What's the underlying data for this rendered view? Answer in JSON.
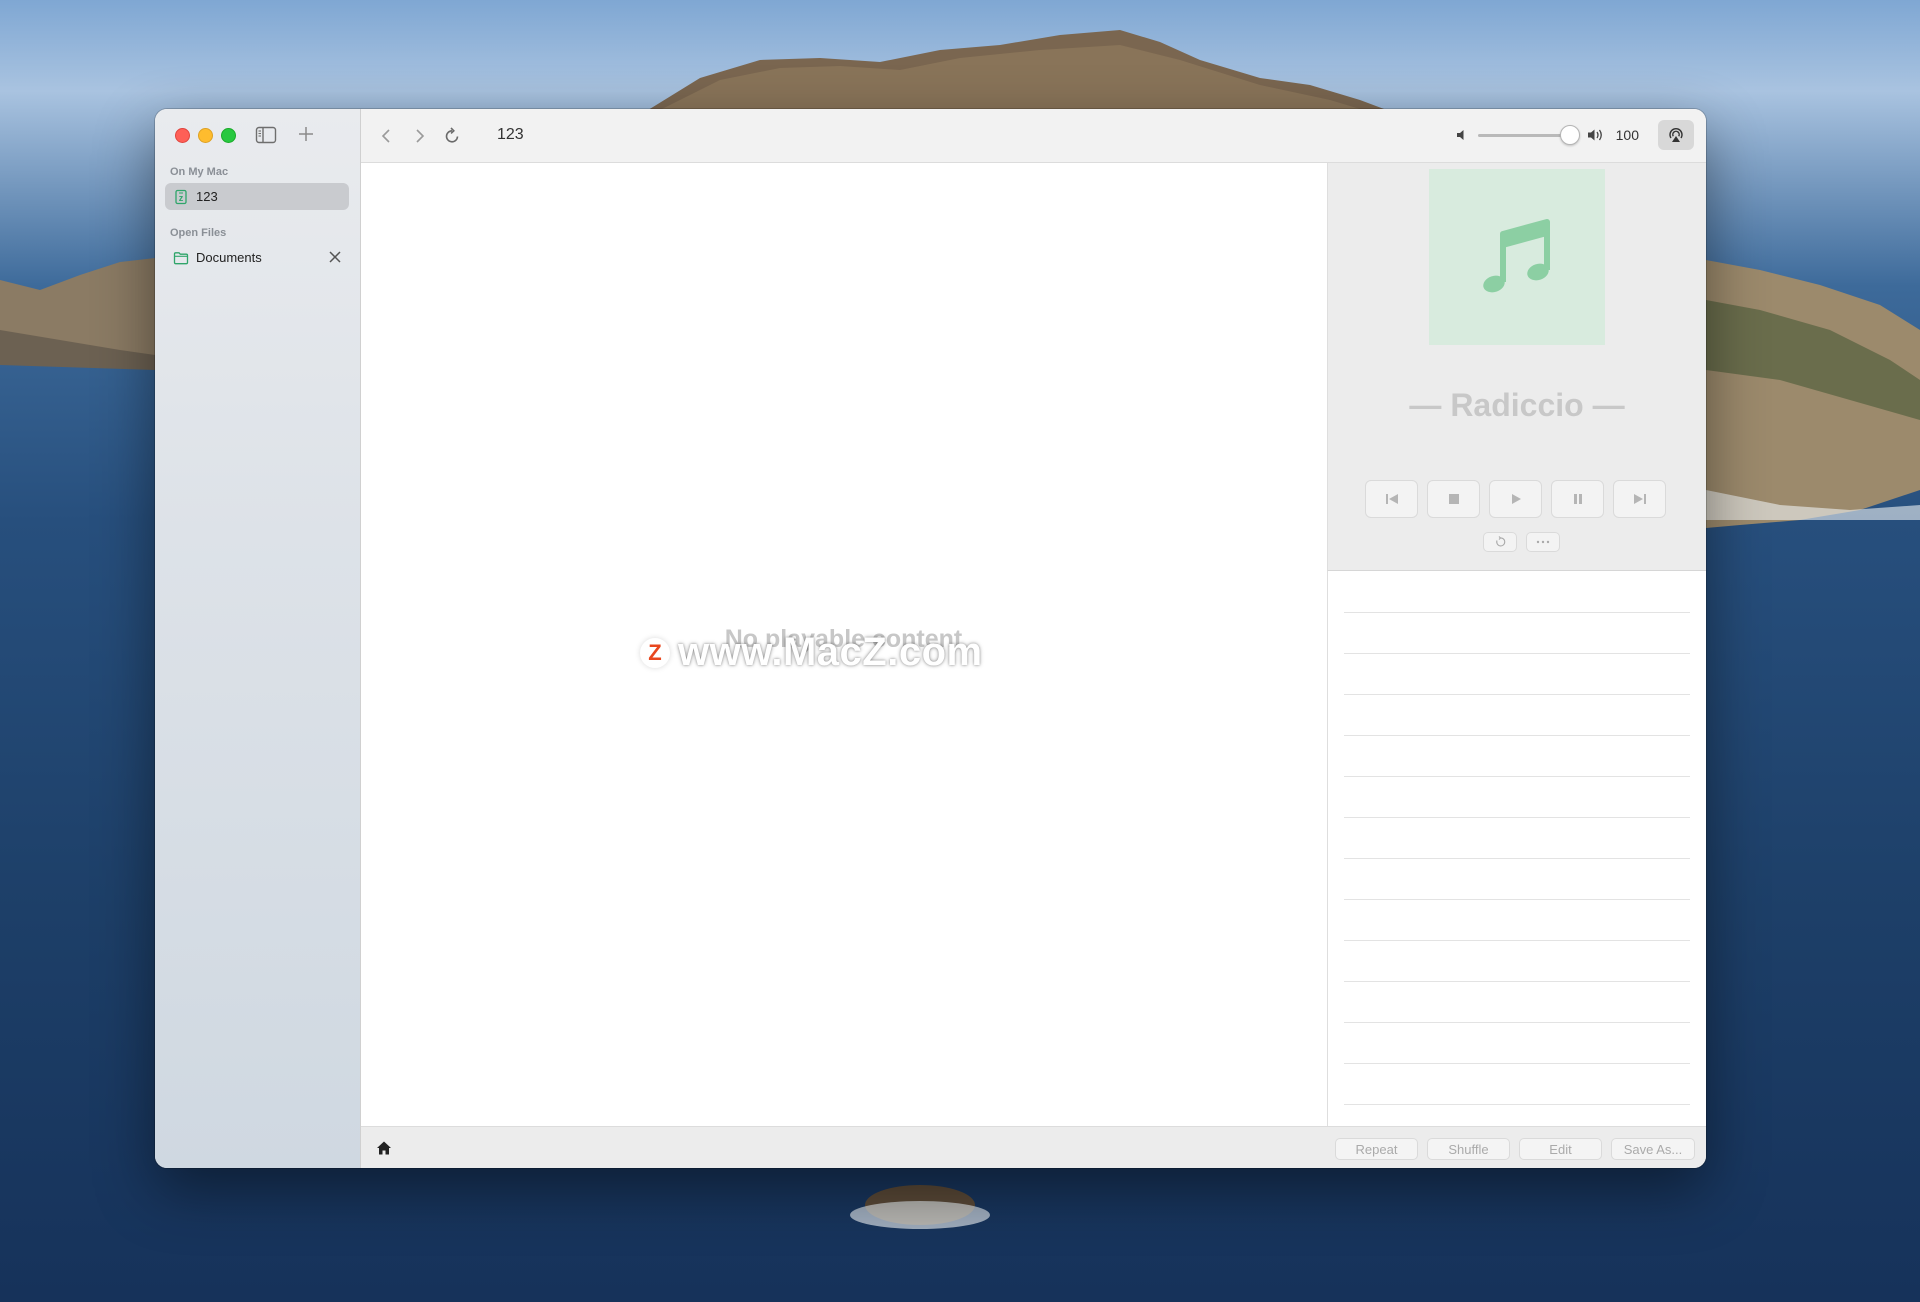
{
  "window": {
    "title": "123"
  },
  "sidebar": {
    "sections": [
      {
        "label": "On My Mac",
        "items": [
          {
            "label": "123",
            "icon": "archive-file-icon",
            "selected": true
          }
        ]
      },
      {
        "label": "Open Files",
        "items": [
          {
            "label": "Documents",
            "icon": "folder-icon",
            "selected": false
          }
        ]
      }
    ]
  },
  "toolbar": {
    "volume_value": "100"
  },
  "content": {
    "empty_message": "No playable content"
  },
  "watermark": {
    "text": "www.MacZ.com",
    "badge_letter": "Z"
  },
  "player": {
    "track_title": "— Radiccio —",
    "art_icon": "music-note-icon",
    "accent": "#8ccfa3"
  },
  "bottombar": {
    "buttons": [
      "Repeat",
      "Shuffle",
      "Edit",
      "Save As..."
    ]
  },
  "playlist": {
    "rows": 13
  }
}
